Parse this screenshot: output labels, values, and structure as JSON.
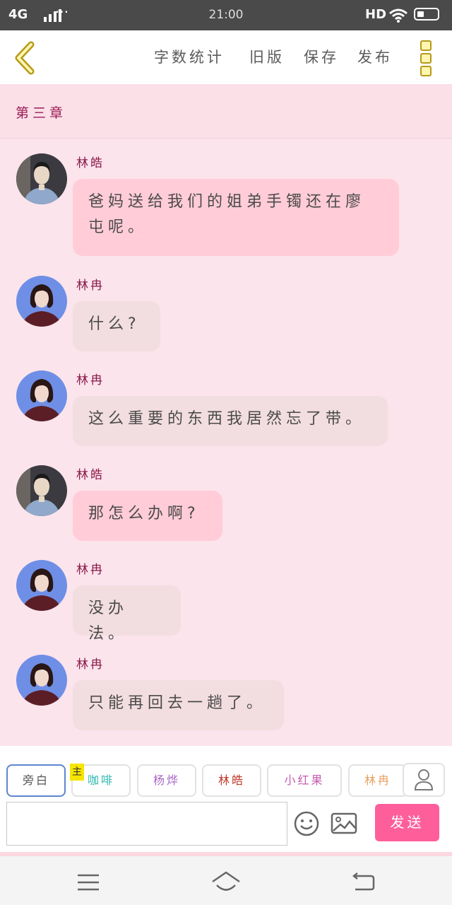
{
  "status": {
    "network": "4G",
    "time": "21:00",
    "hd": "HD"
  },
  "toolbar": {
    "items": [
      "字数统计",
      "旧版",
      "保存",
      "发布"
    ]
  },
  "chapter": "第三章",
  "messages": [
    {
      "speaker": "林皓",
      "text": "爸妈送给我们的姐弟手镯还在廖屯呢。",
      "style": "pink",
      "avatar": "male"
    },
    {
      "speaker": "林冉",
      "text": "什么?",
      "style": "beige",
      "avatar": "female"
    },
    {
      "speaker": "林冉",
      "text": "这么重要的东西我居然忘了带。",
      "style": "beige",
      "avatar": "female"
    },
    {
      "speaker": "林皓",
      "text": "那怎么办啊?",
      "style": "pink",
      "avatar": "male"
    },
    {
      "speaker": "林冉",
      "text": "没办法。",
      "style": "beige",
      "avatar": "female"
    },
    {
      "speaker": "林冉",
      "text": "只能再回去一趟了。",
      "style": "beige",
      "avatar": "female"
    }
  ],
  "roles": [
    {
      "label": "旁白",
      "color": "#555555"
    },
    {
      "label": "咖啡",
      "color": "#2fb8b0"
    },
    {
      "label": "杨烨",
      "color": "#a768c6"
    },
    {
      "label": "林皓",
      "color": "#c0392b"
    },
    {
      "label": "小红果",
      "color": "#c55ab0"
    },
    {
      "label": "林冉",
      "color": "#e8a060"
    }
  ],
  "main_tag": "主",
  "send_label": "发送",
  "input_placeholder": ""
}
